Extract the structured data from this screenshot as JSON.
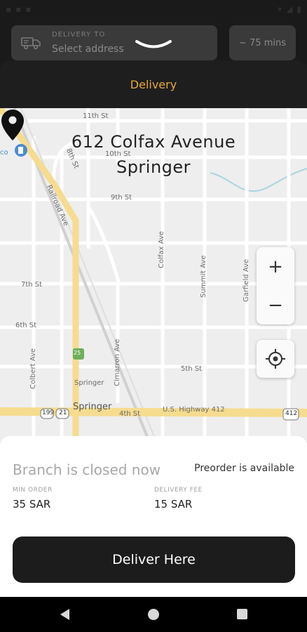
{
  "header": {
    "delivery_to_label": "DELIVERY TO",
    "address_placeholder": "Select address",
    "eta": "~ 75 mins"
  },
  "sheet": {
    "tab_title": "Delivery"
  },
  "map": {
    "selected_address_line1": "612 Colfax Avenue",
    "selected_address_line2": "Springer",
    "labels": {
      "st11": "11th St",
      "st10": "10th St",
      "st9": "9th St",
      "st8": "8th St",
      "st7": "7th St",
      "st6": "6th St",
      "st5": "5th St",
      "st4": "4th St",
      "railroad": "Railroad Ave",
      "colfax": "Colfax Ave",
      "summit": "Summit Ave",
      "garfield": "Garfield Ave",
      "colbert": "Colbert Ave",
      "cimarron": "Cimarron Ave",
      "springer_poi": "Springer",
      "springer_town": "Springer",
      "highway": "U.S. Highway 412",
      "shield_199": "199",
      "shield_21": "21",
      "shield_412": "412",
      "shield_25": "25",
      "poi_fragment": "co"
    },
    "zoom_in": "+",
    "zoom_out": "−"
  },
  "branch": {
    "status": "Branch is closed now",
    "preorder": "Preorder is available",
    "min_order_label": "MIN ORDER",
    "min_order_value": "35 SAR",
    "delivery_fee_label": "DELIVERY FEE",
    "delivery_fee_value": "15 SAR"
  },
  "cta": {
    "label": "Deliver Here"
  },
  "colors": {
    "accent": "#e9a93a",
    "background": "#1a1a1a",
    "button": "#1c1c1c"
  }
}
